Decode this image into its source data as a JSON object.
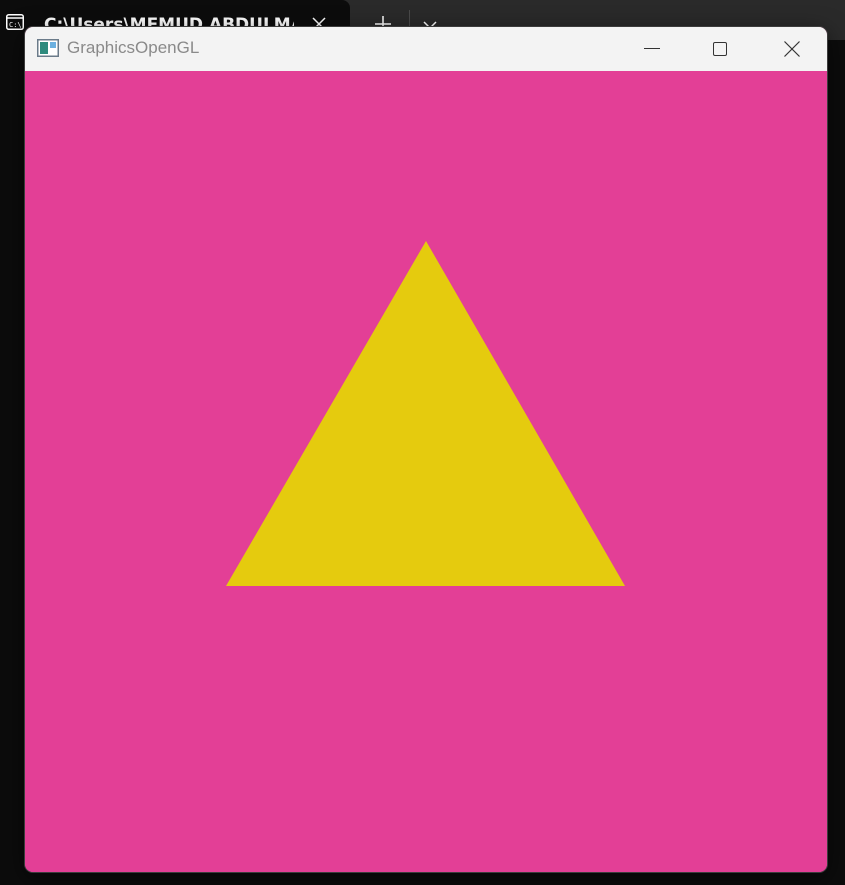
{
  "terminal": {
    "tab_title": "C:\\Users\\MEMUD ABDULMAL",
    "icons": {
      "tab": "command-prompt-icon",
      "close": "close-icon",
      "new_tab": "plus-icon",
      "dropdown": "chevron-down-icon"
    }
  },
  "window": {
    "title": "GraphicsOpenGL",
    "icons": {
      "app": "application-window-icon",
      "minimize": "minimize-icon",
      "maximize": "maximize-icon",
      "close": "close-icon"
    }
  },
  "scene": {
    "clear_color": "#e33f96",
    "triangle_color": "#e5cb0e",
    "vertex_count": 3
  }
}
